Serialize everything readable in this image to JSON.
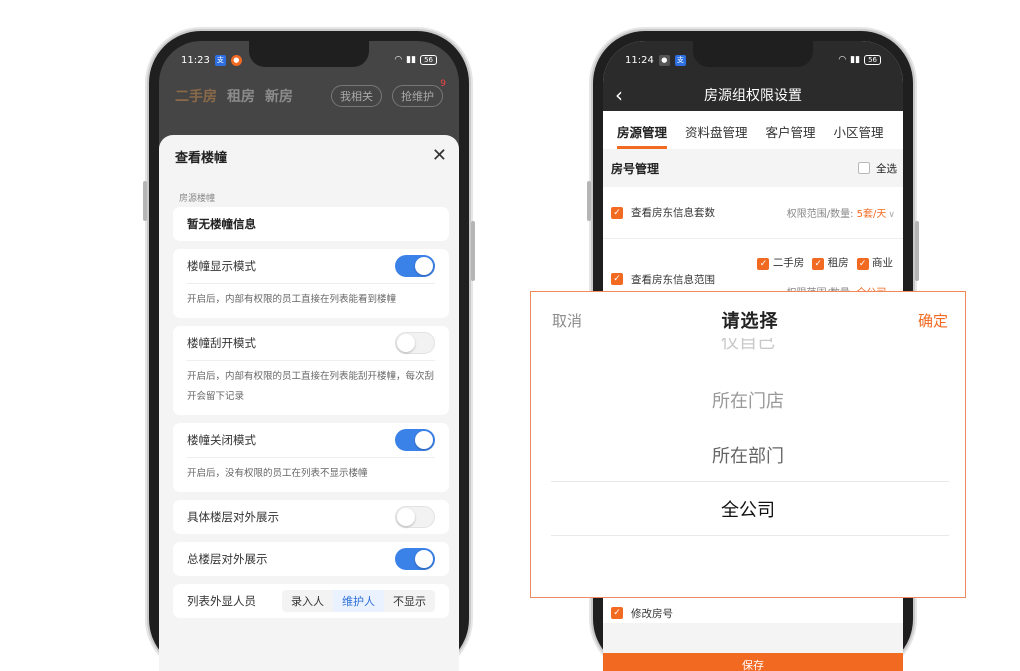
{
  "left_phone": {
    "status": {
      "time": "11:23",
      "battery": "56"
    },
    "bg_tabs": [
      "二手房",
      "租房",
      "新房"
    ],
    "bg_pills": [
      "我相关",
      "抢维护"
    ],
    "bg_pill_badge": "9",
    "sheet": {
      "title": "查看楼幢",
      "section_label": "房源楼幢",
      "no_info": "暂无楼幢信息",
      "settings": [
        {
          "label": "楼幢显示模式",
          "on": true,
          "desc": "开启后，内部有权限的员工直接在列表能看到楼幢"
        },
        {
          "label": "楼幢刮开模式",
          "on": false,
          "desc": "开启后，内部有权限的员工直接在列表能刮开楼幢，每次刮开会留下记录"
        },
        {
          "label": "楼幢关闭模式",
          "on": true,
          "desc": "开启后，没有权限的员工在列表不显示楼幢"
        }
      ],
      "floor_display": {
        "label": "具体楼层对外展示",
        "on": false
      },
      "total_floor": {
        "label": "总楼层对外展示",
        "on": true
      },
      "list_staff": {
        "label": "列表外显人员",
        "options": [
          "录入人",
          "维护人",
          "不显示"
        ],
        "selected": "维护人"
      }
    }
  },
  "right_phone": {
    "status": {
      "time": "11:24",
      "battery": "56"
    },
    "title": "房源组权限设置",
    "tabs": [
      "房源管理",
      "资料盘管理",
      "客户管理",
      "小区管理"
    ],
    "active_tab": "房源管理",
    "group": {
      "name": "房号管理",
      "select_all": "全选"
    },
    "perm1": {
      "label": "查看房东信息套数",
      "scope_label": "权限范围/数量:",
      "scope_value": "5套/天"
    },
    "perm2": {
      "label": "查看房东信息范围",
      "types": [
        "二手房",
        "租房",
        "商业"
      ],
      "scope_label": "权限范围/数量:",
      "scope_value": "全公司"
    },
    "perm3": {
      "label": "修改房号"
    },
    "save": "保存"
  },
  "picker": {
    "cancel": "取消",
    "title": "请选择",
    "confirm": "确定",
    "partial_option": "仅自己",
    "options": [
      "所在门店",
      "所在部门",
      "全公司"
    ],
    "selected": "全公司"
  },
  "colors": {
    "accent_orange": "#f26a21",
    "toggle_blue": "#3b82e8"
  }
}
